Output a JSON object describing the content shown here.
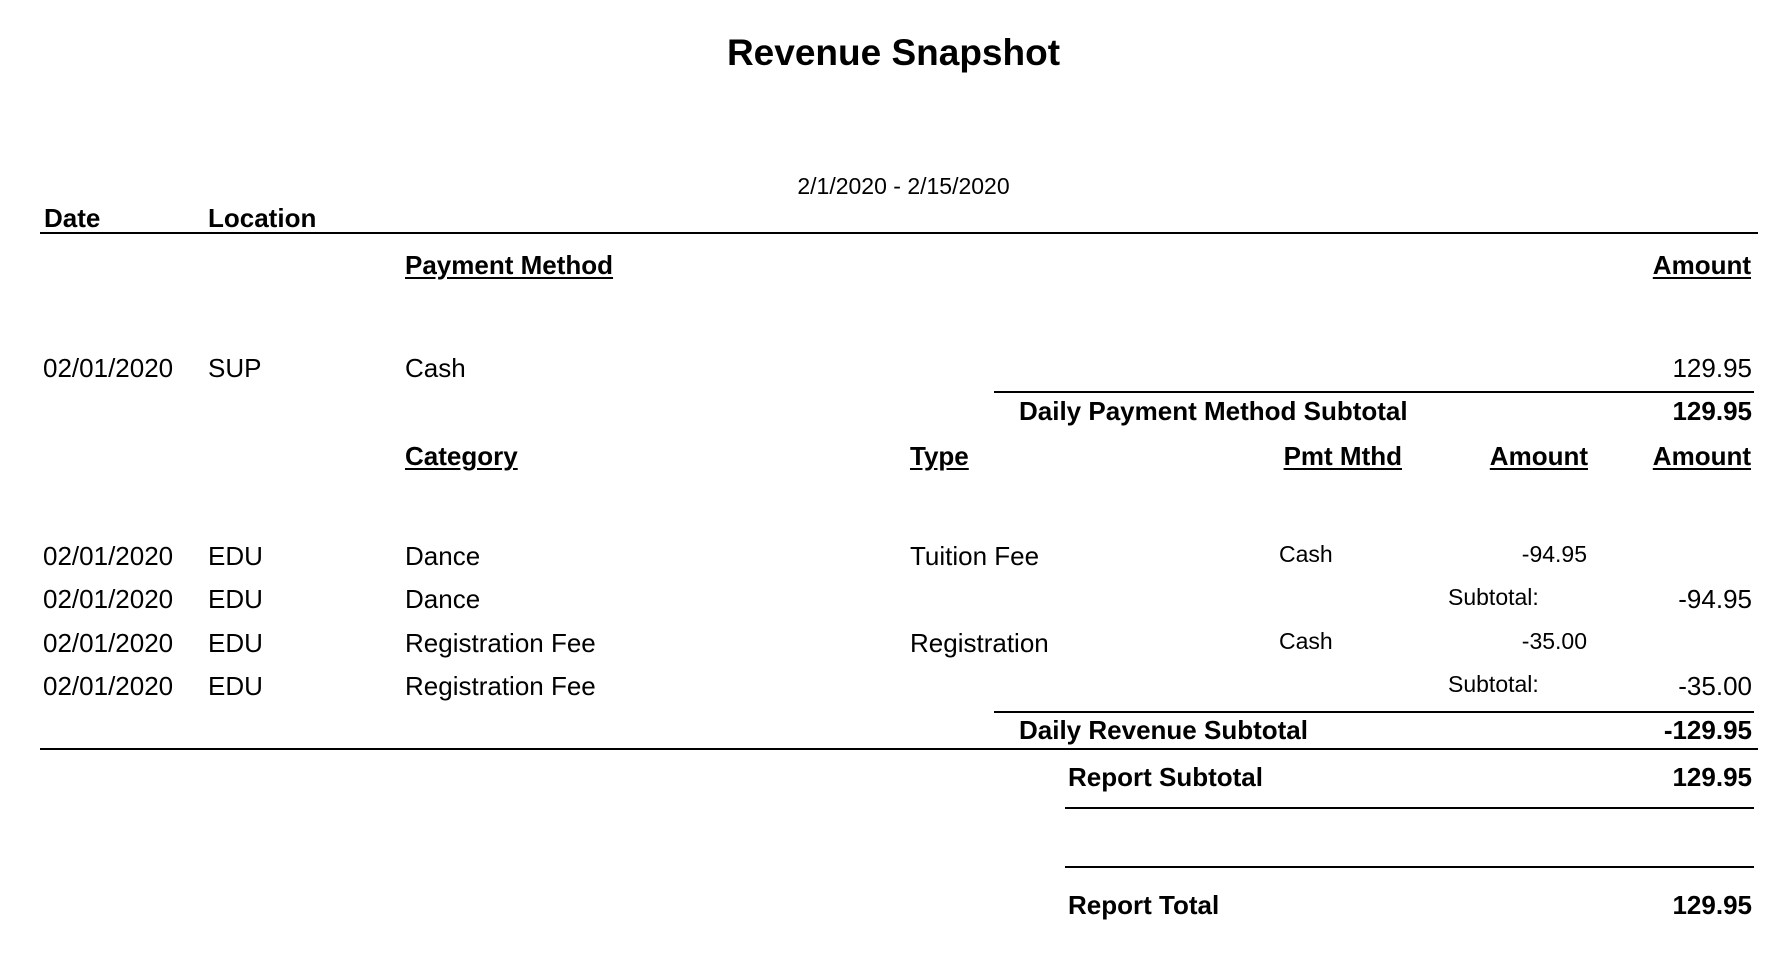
{
  "report": {
    "title": "Revenue Snapshot",
    "date_range": "2/1/2020 - 2/15/2020"
  },
  "top_headers": {
    "date": "Date",
    "location": "Location"
  },
  "payment_section": {
    "headers": {
      "payment_method": "Payment Method",
      "amount": "Amount"
    },
    "rows": [
      {
        "date": "02/01/2020",
        "location": "SUP",
        "method": "Cash",
        "amount": "129.95"
      }
    ],
    "subtotal_label": "Daily Payment Method Subtotal",
    "subtotal_value": "129.95"
  },
  "revenue_section": {
    "headers": {
      "category": "Category",
      "type": "Type",
      "pmt_mthd": "Pmt Mthd",
      "amount1": "Amount",
      "amount2": "Amount"
    },
    "rows": [
      {
        "date": "02/01/2020",
        "location": "EDU",
        "category": "Dance",
        "type": "Tuition Fee",
        "pmt": "Cash",
        "amount": "-94.95"
      },
      {
        "date": "02/01/2020",
        "location": "EDU",
        "category": "Dance",
        "sub_label": "Subtotal:",
        "sub_value": "-94.95"
      },
      {
        "date": "02/01/2020",
        "location": "EDU",
        "category": "Registration Fee",
        "type": "Registration",
        "pmt": "Cash",
        "amount": "-35.00"
      },
      {
        "date": "02/01/2020",
        "location": "EDU",
        "category": "Registration Fee",
        "sub_label": "Subtotal:",
        "sub_value": "-35.00"
      }
    ],
    "subtotal_label": "Daily Revenue Subtotal",
    "subtotal_value": "-129.95"
  },
  "totals": {
    "report_subtotal_label": "Report Subtotal",
    "report_subtotal_value": "129.95",
    "report_total_label": "Report Total",
    "report_total_value": "129.95"
  }
}
